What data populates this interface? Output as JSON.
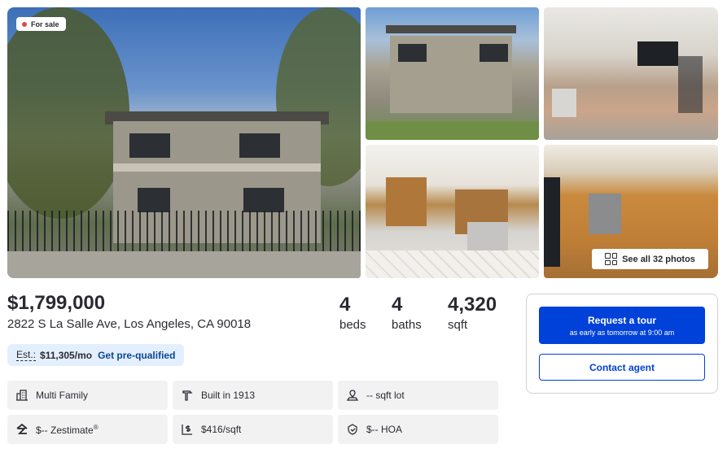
{
  "gallery": {
    "status_badge": "For sale",
    "see_all_label": "See all 32 photos"
  },
  "listing": {
    "price": "$1,799,000",
    "address": "2822 S La Salle Ave, Los Angeles, CA 90018",
    "beds": {
      "value": "4",
      "label": "beds"
    },
    "baths": {
      "value": "4",
      "label": "baths"
    },
    "sqft": {
      "value": "4,320",
      "label": "sqft"
    }
  },
  "estimate": {
    "label": "Est.:",
    "monthly": "$11,305/mo",
    "link": "Get pre-qualified"
  },
  "facts": [
    {
      "icon": "building-icon",
      "text": "Multi Family"
    },
    {
      "icon": "hammer-icon",
      "text": "Built in 1913"
    },
    {
      "icon": "lot-size-icon",
      "text": "-- sqft lot"
    },
    {
      "icon": "zestimate-icon",
      "text": "$-- Zestimate",
      "sup": "®"
    },
    {
      "icon": "price-per-sqft-icon",
      "text": "$416/sqft"
    },
    {
      "icon": "hoa-icon",
      "text": "$-- HOA"
    }
  ],
  "cta": {
    "tour_title": "Request a tour",
    "tour_subtitle": "as early as tomorrow at 9:00 am",
    "contact_label": "Contact agent"
  },
  "colors": {
    "primary": "#0041d9",
    "badge_dot": "#e3474c",
    "estimate_bg": "#e3effc",
    "fact_bg": "#f2f2f3"
  }
}
